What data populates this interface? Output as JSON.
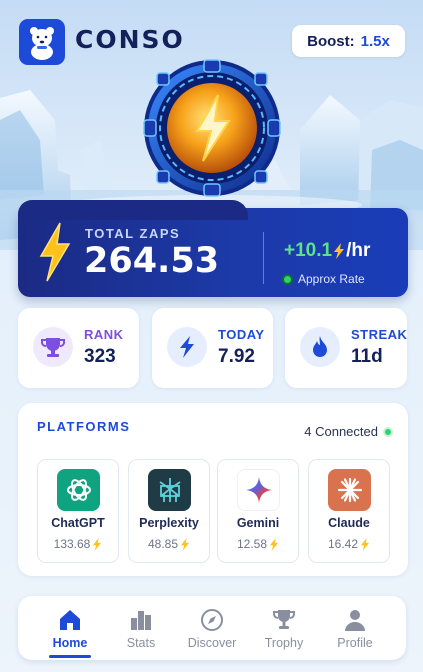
{
  "header": {
    "app_name": "CONSO",
    "boost_label": "Boost:",
    "boost_value": "1.5x",
    "logo_icon": "polar-bear-icon"
  },
  "hero": {
    "icon": "lightning-orb-icon"
  },
  "zaps": {
    "label": "TOTAL ZAPS",
    "value": "264.53",
    "rate_value": "+10.1",
    "rate_unit": "/hr",
    "approx_label": "Approx Rate"
  },
  "stats": [
    {
      "label": "RANK",
      "value": "323",
      "icon": "trophy-icon",
      "color": "#7b4fe0"
    },
    {
      "label": "TODAY",
      "value": "7.92",
      "icon": "lightning-icon",
      "color": "#1d4bd8"
    },
    {
      "label": "STREAK",
      "value": "11d",
      "icon": "flame-icon",
      "color": "#1d4bd8"
    }
  ],
  "platforms": {
    "title": "PLATFORMS",
    "connected": "4 Connected",
    "items": [
      {
        "name": "ChatGPT",
        "score": "133.68",
        "icon": "chatgpt-icon",
        "color": "#10a37f"
      },
      {
        "name": "Perplexity",
        "score": "48.85",
        "icon": "perplexity-icon",
        "color": "#1f3b45"
      },
      {
        "name": "Gemini",
        "score": "12.58",
        "icon": "gemini-icon",
        "color": "#ffffff"
      },
      {
        "name": "Claude",
        "score": "16.42",
        "icon": "claude-icon",
        "color": "#d9734e"
      }
    ]
  },
  "nav": [
    {
      "label": "Home",
      "icon": "home-icon",
      "active": true
    },
    {
      "label": "Stats",
      "icon": "stats-icon",
      "active": false
    },
    {
      "label": "Discover",
      "icon": "compass-icon",
      "active": false
    },
    {
      "label": "Trophy",
      "icon": "trophy-icon",
      "active": false
    },
    {
      "label": "Profile",
      "icon": "person-icon",
      "active": false
    }
  ],
  "colors": {
    "accent": "#1d4bd8",
    "dark_navy": "#13205a",
    "zap_yellow": "#ffc21a",
    "success": "#2bd46b"
  }
}
